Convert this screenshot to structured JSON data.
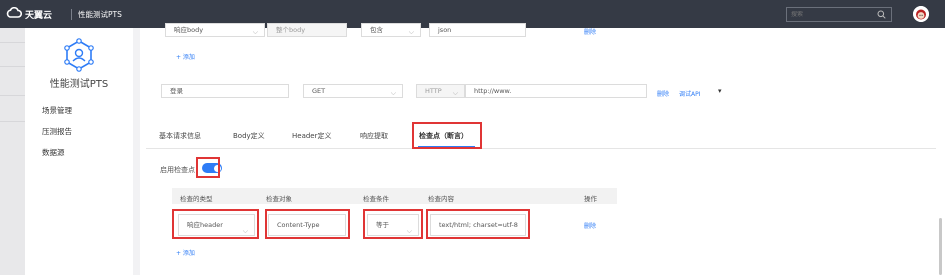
{
  "header": {
    "brand": "天翼云",
    "product": "性能测试PTS",
    "search_placeholder": "搜索"
  },
  "sidebar": {
    "title": "性能测试PTS",
    "items": [
      {
        "label": "场景管理"
      },
      {
        "label": "压测报告"
      },
      {
        "label": "数据源"
      }
    ]
  },
  "top_row": {
    "select_body": "响应body",
    "body_placeholder": "整个body",
    "condition": "包含",
    "content": "json",
    "delete": "删除"
  },
  "add_label": "+ 添加",
  "request": {
    "name": "登录",
    "method": "GET",
    "protocol": "HTTP",
    "url": "http://www.",
    "delete": "删除",
    "debug": "调试API",
    "more": "▾"
  },
  "tabs": [
    {
      "label": "基本请求信息"
    },
    {
      "label": "Body定义"
    },
    {
      "label": "Header定义"
    },
    {
      "label": "响应提取"
    },
    {
      "label": "检查点（断言）"
    }
  ],
  "checkpoint": {
    "enable_label": "启用检查点",
    "enabled": true,
    "columns": [
      "检查的类型",
      "检查对象",
      "检查条件",
      "检查内容",
      "操作"
    ],
    "row": {
      "type": "响应header",
      "object": "Content-Type",
      "condition": "等于",
      "content": "text/html; charset=utf-8",
      "delete": "删除"
    },
    "add_label": "+ 添加"
  },
  "colors": {
    "accent": "#2e7cf6",
    "topbar": "#353a45",
    "highlight": "#e03535"
  }
}
